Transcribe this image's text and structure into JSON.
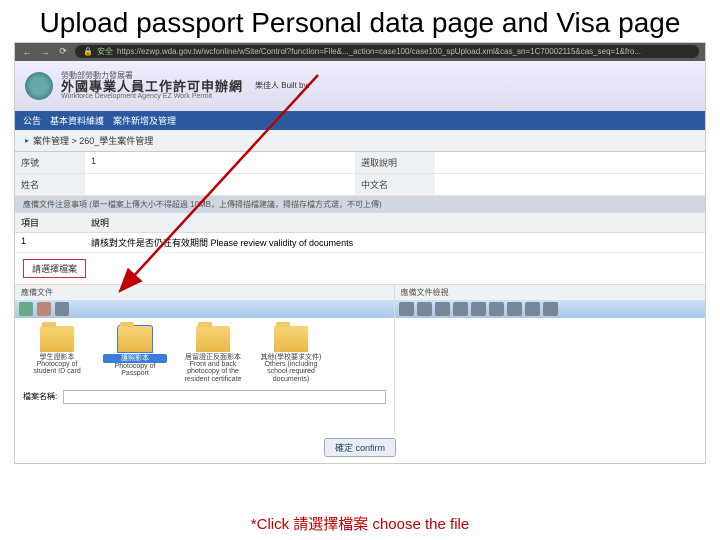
{
  "slide": {
    "title": "Upload passport Personal data page and Visa page",
    "footer": "*Click 請選擇檔案 choose the file"
  },
  "browser": {
    "secure": "安全",
    "url": "https://ezwp.wda.gov.tw/wcfonline/wSite/Control?function=File&..._action=case100/case100_spUpload.xml&cas_sn=1C70002115&cas_seq=1&fro..."
  },
  "site": {
    "cn_small": "勞動部勞動力發展署",
    "built_label": "樂佳人 Built by:",
    "main_title": "外國專業人員工作許可申辦網",
    "en_title": "Workforce Development Agency EZ Work Permit"
  },
  "nav": {
    "items": "公告　基本資料維護　案件新增及管理"
  },
  "breadcrumb": {
    "path": "案件管理 > 260_學生案件管理"
  },
  "form": {
    "serial_lbl": "序號",
    "serial_val": "1",
    "select_desc_lbl": "選取說明",
    "name_lbl": "姓名",
    "chinese_name_lbl": "中文名",
    "note": "應備文件注意事項 (單一檔案上傳大小不得超過 10MB，上傳掃描檔建議，掃描存檔方式選，不可上傳)",
    "item_lbl": "項目",
    "desc_lbl": "說明",
    "item_no": "1",
    "item_desc": "請核對文件是否仍在有效期間 Please review validity of documents"
  },
  "choose": {
    "label": "請選擇檔案"
  },
  "panel": {
    "left_head": "應備文件",
    "right_head": "應備文件檢視",
    "filename_lbl": "檔案名稱:",
    "filename_val": ""
  },
  "folders": [
    {
      "caption": "學生證影本",
      "sub": "Photocopy of student ID card"
    },
    {
      "caption": "護照影本",
      "sub": "Photocopy of Passport"
    },
    {
      "caption": "居留證正反面影本",
      "sub": "Front and back photocopy of the resident certificate"
    },
    {
      "caption": "其他(學校要求文件)",
      "sub": "Others (including school required documents)"
    }
  ],
  "confirm": {
    "label": "確定 confirm"
  }
}
